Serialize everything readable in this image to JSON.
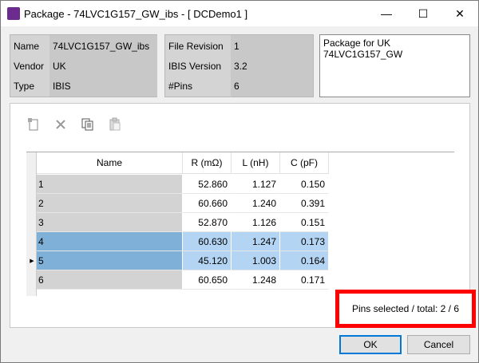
{
  "window": {
    "title": "Package - 74LVC1G157_GW_ibs - [ DCDemo1 ]",
    "minimize_glyph": "—",
    "maximize_glyph": "☐",
    "close_glyph": "✕"
  },
  "info_left": {
    "rows": [
      {
        "label": "Name",
        "value": "74LVC1G157_GW_ibs"
      },
      {
        "label": "Vendor",
        "value": "UK"
      },
      {
        "label": "Type",
        "value": "IBIS"
      }
    ]
  },
  "info_right": {
    "rows": [
      {
        "label": "File Revision",
        "value": "1"
      },
      {
        "label": "IBIS Version",
        "value": "3.2"
      },
      {
        "label": "#Pins",
        "value": "6"
      }
    ]
  },
  "description": "Package for UK 74LVC1G157_GW",
  "toolbar": {
    "icons": [
      "new-doc-icon",
      "delete-icon",
      "copy-icon",
      "paste-icon"
    ]
  },
  "table": {
    "columns": [
      "Name",
      "R (mΩ)",
      "L (nH)",
      "C (pF)"
    ],
    "rows": [
      {
        "name": "1",
        "r": "52.860",
        "l": "1.127",
        "c": "0.150",
        "selected": false
      },
      {
        "name": "2",
        "r": "60.660",
        "l": "1.240",
        "c": "0.391",
        "selected": false
      },
      {
        "name": "3",
        "r": "52.870",
        "l": "1.126",
        "c": "0.151",
        "selected": false
      },
      {
        "name": "4",
        "r": "60.630",
        "l": "1.247",
        "c": "0.173",
        "selected": true
      },
      {
        "name": "5",
        "r": "45.120",
        "l": "1.003",
        "c": "0.164",
        "selected": true
      },
      {
        "name": "6",
        "r": "60.650",
        "l": "1.248",
        "c": "0.171",
        "selected": false
      }
    ]
  },
  "status": "Pins selected / total: 2 / 6",
  "buttons": {
    "ok": "OK",
    "cancel": "Cancel"
  },
  "colors": {
    "selection_name": "#7fb0d8",
    "selection_value": "#b3d5f3",
    "highlight_box": "#ff0000"
  }
}
